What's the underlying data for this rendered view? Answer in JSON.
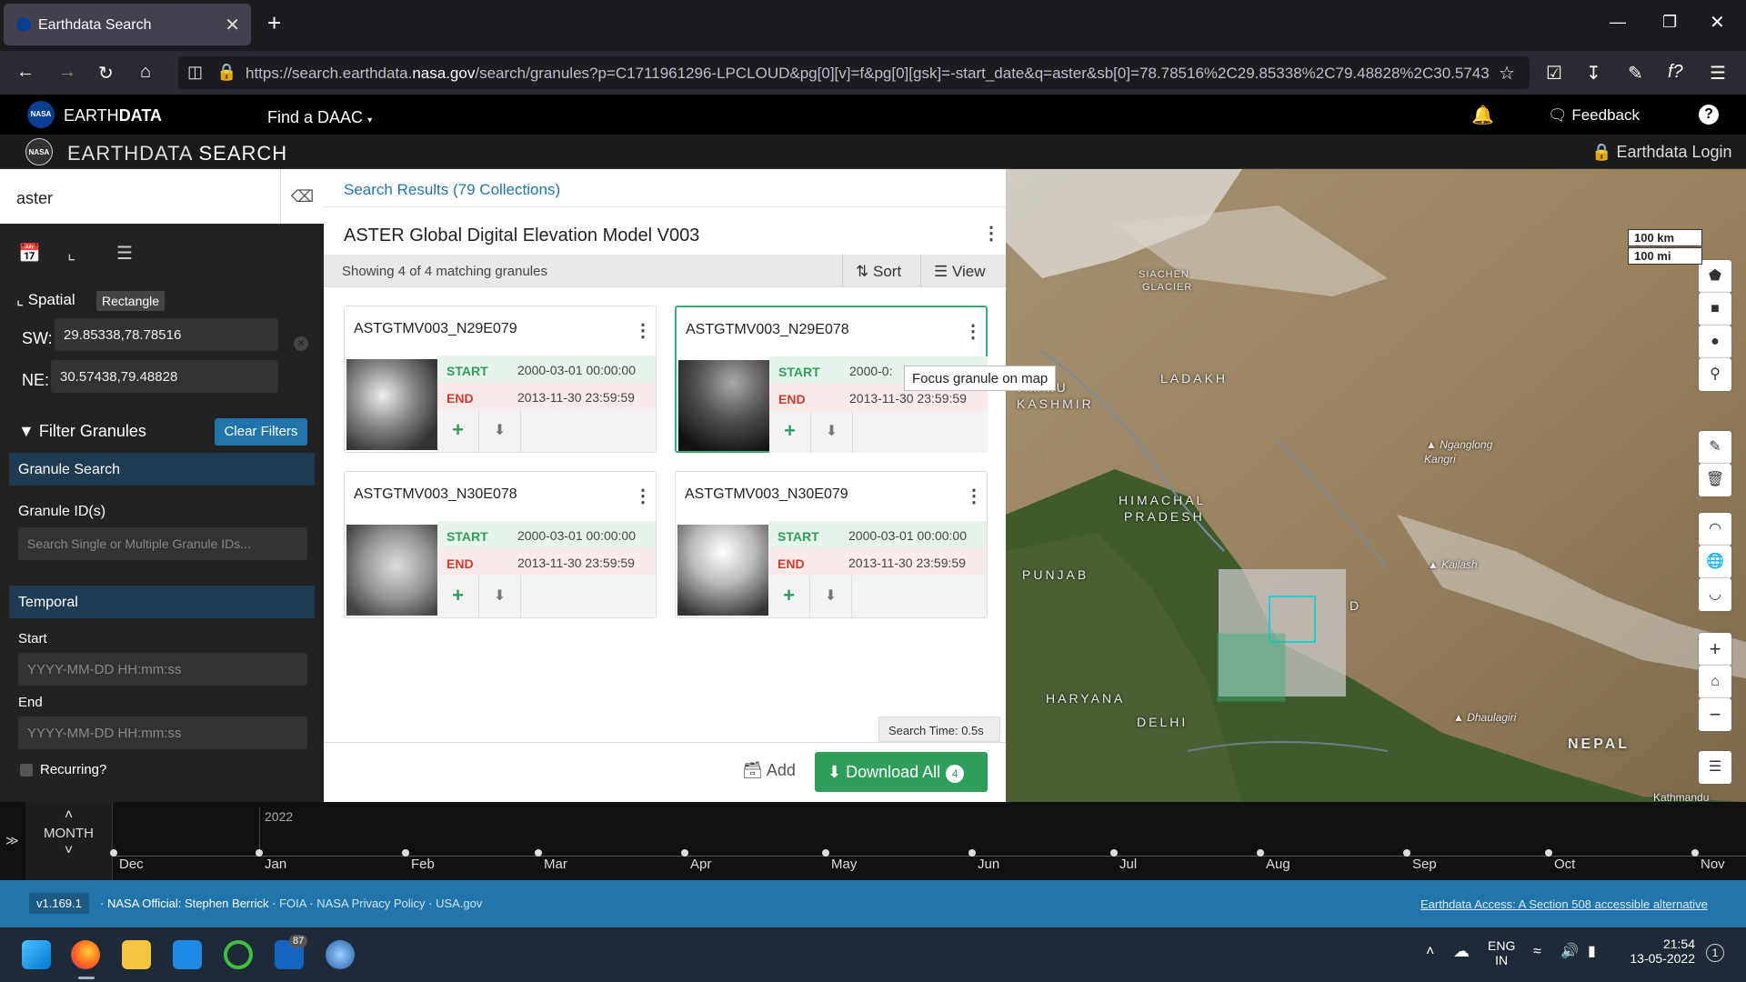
{
  "browser": {
    "tab_title": "Earthdata Search",
    "tab_close": "✕",
    "new_tab": "+",
    "url_prefix": "https://search.earthdata.",
    "url_domain": "nasa.gov",
    "url_rest": "/search/granules?p=C1711961296-LPCLOUD&pg[0][v]=f&pg[0][gsk]=-start_date&q=aster&sb[0]=78.78516%2C29.85338%2C79.48828%2C30.5743"
  },
  "earthdata_header": {
    "brand_light": "EARTH",
    "brand_bold": "DATA",
    "find_daac": "Find a DAAC",
    "feedback": "Feedback",
    "help": "?"
  },
  "search_header": {
    "brand_light": "EARTHDATA",
    "brand_bold": "SEARCH",
    "login": "Earthdata Login"
  },
  "sidebar": {
    "query": "aster",
    "spatial_label": "Spatial",
    "spatial_type": "Rectangle",
    "sw_label": "SW:",
    "sw_value": "29.85338,78.78516",
    "ne_label": "NE:",
    "ne_value": "30.57438,79.48828",
    "filter_title": "Filter Granules",
    "clear_filters": "Clear Filters",
    "granule_search": "Granule Search",
    "granule_ids_label": "Granule ID(s)",
    "granule_ids_placeholder": "Search Single or Multiple Granule IDs...",
    "temporal": "Temporal",
    "start_label": "Start",
    "end_label": "End",
    "date_placeholder": "YYYY-MM-DD HH:mm:ss",
    "recurring": "Recurring?"
  },
  "results": {
    "breadcrumb": "Search Results (79 Collections)",
    "collection_title": "ASTER Global Digital Elevation Model V003",
    "showing": "Showing 4 of 4 matching granules",
    "sort": "Sort",
    "view": "View",
    "start_key": "START",
    "end_key": "END",
    "granules": [
      {
        "name": "ASTGTMV003_N29E079",
        "start": "2000-03-01 00:00:00",
        "end": "2013-11-30 23:59:59"
      },
      {
        "name": "ASTGTMV003_N29E078",
        "start": "2000-03-01 00:00:00",
        "end": "2013-11-30 23:59:59",
        "start_shown": "2000-0:"
      },
      {
        "name": "ASTGTMV003_N30E078",
        "start": "2000-03-01 00:00:00",
        "end": "2013-11-30 23:59:59"
      },
      {
        "name": "ASTGTMV003_N30E079",
        "start": "2000-03-01 00:00:00",
        "end": "2013-11-30 23:59:59"
      }
    ],
    "tooltip": "Focus granule on map",
    "search_time": "Search Time: 0.5s",
    "add": "Add",
    "download_all": "Download All",
    "download_count": "4"
  },
  "map": {
    "scale_km": "100 km",
    "scale_mi": "100 mi",
    "labels": {
      "siachen": "SIACHEN",
      "glacier": "GLACIER",
      "ladakh": "LADAKH",
      "jammu": "AMMU",
      "kashmir": "KASHMIR",
      "himachal": "HIMACHAL",
      "pradesh": "PRADESH",
      "punjab": "PUNJAB",
      "haryana": "HARYANA",
      "delhi": "DELHI",
      "nepal": "NEPAL",
      "nganglong": "Nganglong",
      "kangri": "Kangri",
      "kailash": "Kailash",
      "dhaulagiri": "Dhaulagiri",
      "kathmandu": "Kathmandu",
      "partial_d": "D"
    }
  },
  "timeline": {
    "unit": "MONTH",
    "year": "2022",
    "months": [
      "Dec",
      "Jan",
      "Feb",
      "Mar",
      "Apr",
      "May",
      "Jun",
      "Jul",
      "Aug",
      "Sep",
      "Oct",
      "Nov"
    ]
  },
  "footer": {
    "version": "v1.169.1",
    "official": "NASA Official: Stephen Berrick",
    "foia": "FOIA",
    "privacy": "NASA Privacy Policy",
    "usagov": "USA.gov",
    "sep": "·",
    "accessible": "Earthdata Access: A Section 508 accessible alternative"
  },
  "taskbar": {
    "badge": "87",
    "lang1": "ENG",
    "lang2": "IN",
    "time": "21:54",
    "date": "13-05-2022"
  },
  "colors": {
    "accent_blue": "#2275aa",
    "green": "#2f9e5a",
    "red": "#d23a2a"
  }
}
